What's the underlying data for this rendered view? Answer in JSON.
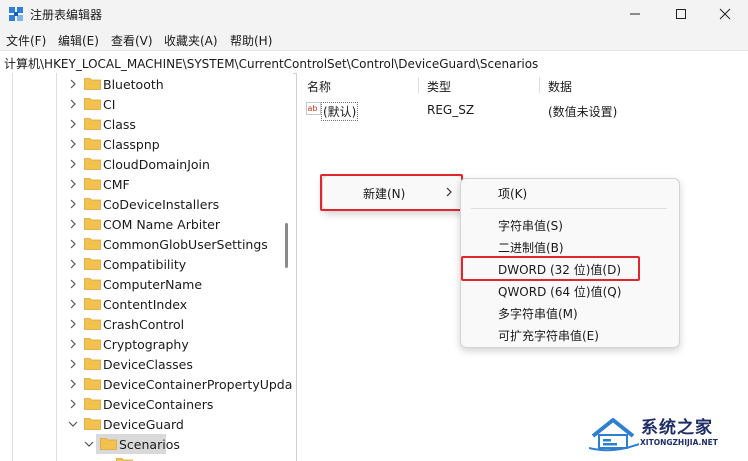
{
  "window": {
    "title": "注册表编辑器"
  },
  "menu": {
    "items": [
      "文件(F)",
      "编辑(E)",
      "查看(V)",
      "收藏夹(A)",
      "帮助(H)"
    ]
  },
  "address": {
    "path": "计算机\\HKEY_LOCAL_MACHINE\\SYSTEM\\CurrentControlSet\\Control\\DeviceGuard\\Scenarios"
  },
  "tree": {
    "items": [
      "Bluetooth",
      "CI",
      "Class",
      "Classpnp",
      "CloudDomainJoin",
      "CMF",
      "CoDeviceInstallers",
      "COM Name Arbiter",
      "CommonGlobUserSettings",
      "Compatibility",
      "ComputerName",
      "ContentIndex",
      "CrashControl",
      "Cryptography",
      "DeviceClasses",
      "DeviceContainerPropertyUpda",
      "DeviceContainers",
      "DeviceGuard"
    ],
    "selected": "Scenarios"
  },
  "list": {
    "columns": {
      "name": "名称",
      "type": "类型",
      "data": "数据"
    },
    "rows": [
      {
        "name": "(默认)",
        "type": "REG_SZ",
        "data": "(数值未设置)"
      }
    ]
  },
  "context_menu": {
    "new_label": "新建(N)",
    "submenu": {
      "key": "项(K)",
      "string": "字符串值(S)",
      "binary": "二进制值(B)",
      "dword": "DWORD (32 位)值(D)",
      "qword": "QWORD (64 位)值(Q)",
      "multi_string": "多字符串值(M)",
      "expandable_string": "可扩充字符串值(E)"
    }
  },
  "watermark": {
    "brand": "系统之家",
    "url": "XITONGZHIJIA.NET"
  },
  "colors": {
    "highlight_box": "#e0262e",
    "folder": "#f2c14e",
    "selection": "#d9d9d9"
  }
}
